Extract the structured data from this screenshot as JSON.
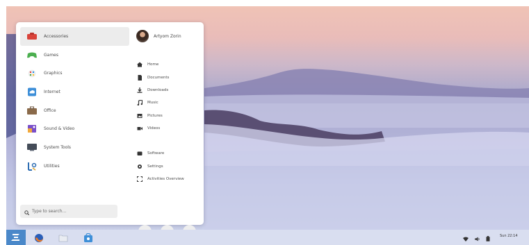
{
  "menu": {
    "categories": [
      {
        "label": "Accessories",
        "icon": "accessories-icon",
        "color": "#d9433a",
        "active": true
      },
      {
        "label": "Games",
        "icon": "games-icon",
        "color": "#4caf50"
      },
      {
        "label": "Graphics",
        "icon": "graphics-icon",
        "color": "#f0b73c"
      },
      {
        "label": "Internet",
        "icon": "internet-icon",
        "color": "#3e8fd8"
      },
      {
        "label": "Office",
        "icon": "office-icon",
        "color": "#8a6a4a"
      },
      {
        "label": "Sound & Video",
        "icon": "sound-video-icon",
        "color": "#7a4fc9"
      },
      {
        "label": "System Tools",
        "icon": "system-tools-icon",
        "color": "#444c58"
      },
      {
        "label": "Utilities",
        "icon": "utilities-icon",
        "color": "#2d6db3"
      }
    ],
    "search": {
      "placeholder": "Type to search..."
    },
    "user": {
      "name": "Artyom Zorin"
    },
    "places": [
      {
        "label": "Home",
        "icon": "home-icon"
      },
      {
        "label": "Documents",
        "icon": "documents-icon"
      },
      {
        "label": "Downloads",
        "icon": "downloads-icon"
      },
      {
        "label": "Music",
        "icon": "music-icon"
      },
      {
        "label": "Pictures",
        "icon": "pictures-icon"
      },
      {
        "label": "Videos",
        "icon": "videos-icon"
      }
    ],
    "system": [
      {
        "label": "Software",
        "icon": "software-icon"
      },
      {
        "label": "Settings",
        "icon": "settings-icon"
      },
      {
        "label": "Activities Overview",
        "icon": "activities-overview-icon"
      }
    ],
    "power_buttons": [
      "suspend-icon",
      "lock-icon",
      "power-icon"
    ]
  },
  "taskbar": {
    "launcher_icon": "zorin-menu-icon",
    "apps": [
      "firefox-icon",
      "files-icon",
      "software-store-icon"
    ],
    "tray": [
      "wifi-icon",
      "volume-icon",
      "battery-icon"
    ],
    "clock": "Sun 22:14"
  },
  "colors": {
    "accent": "#4a88c9",
    "panel": "#d9def0"
  }
}
